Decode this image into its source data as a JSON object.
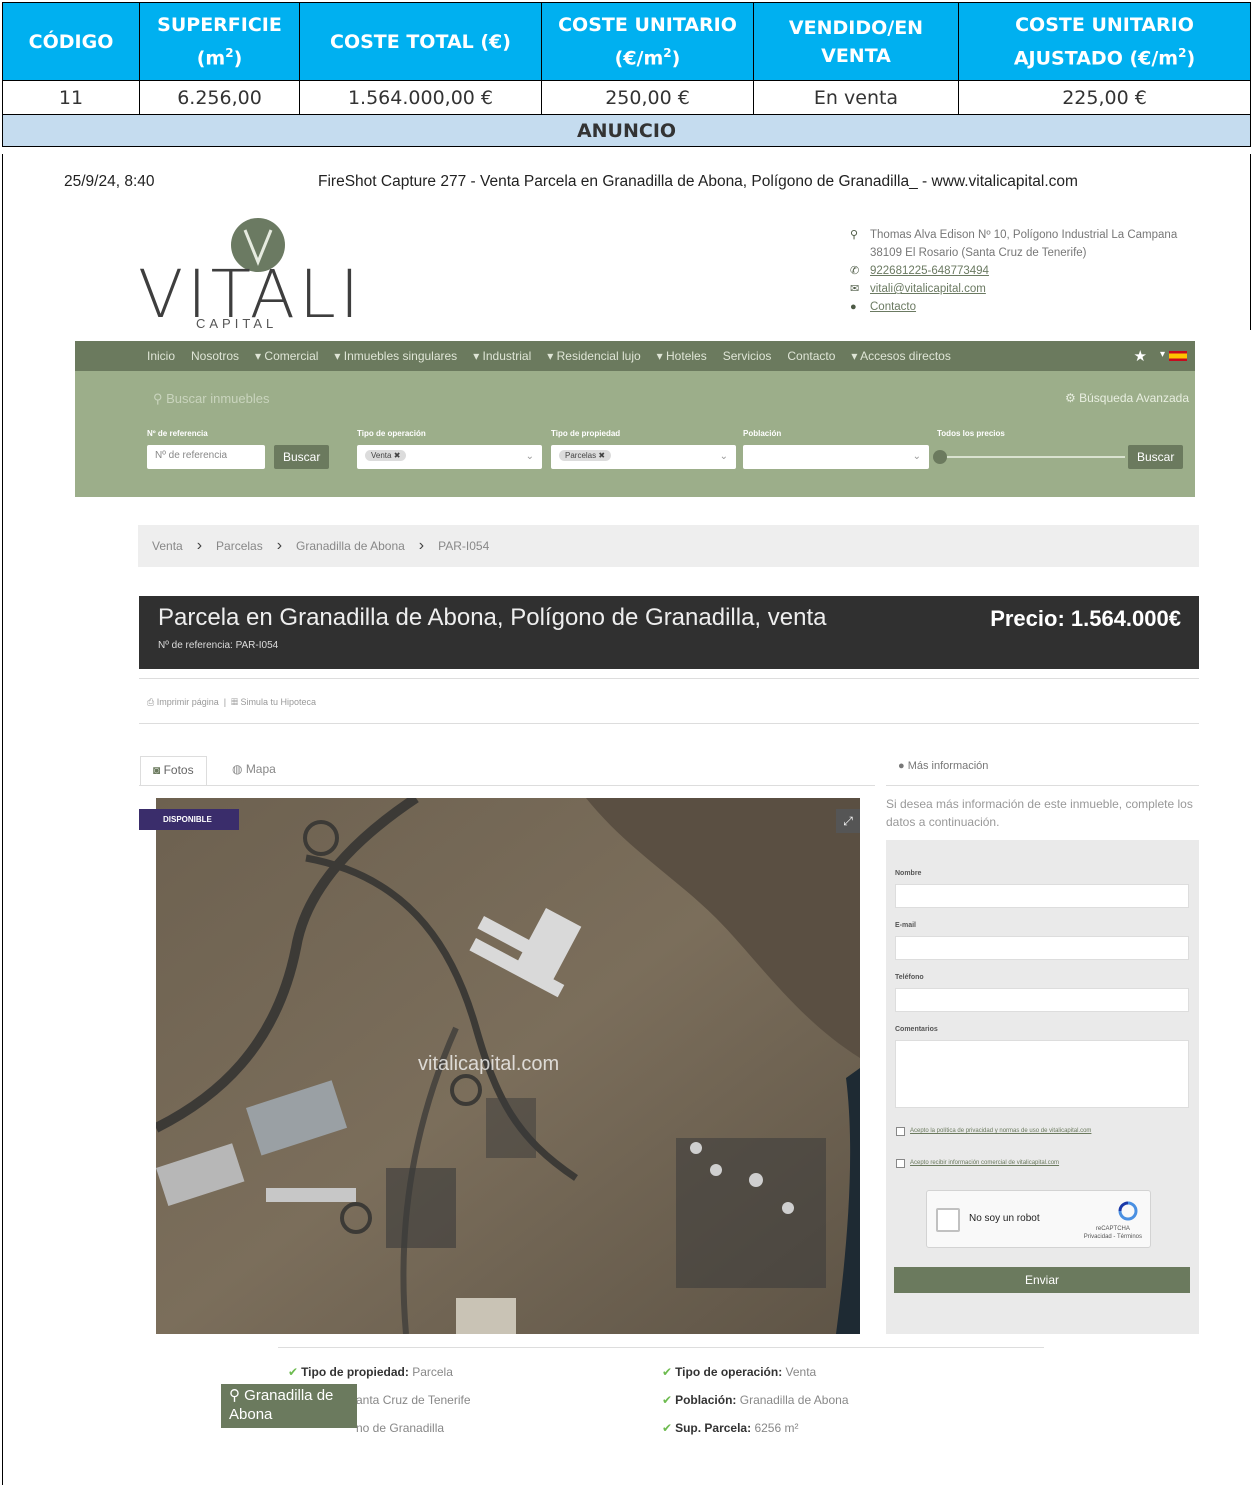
{
  "table": {
    "headers": [
      "CÓDIGO",
      "SUPERFICIE (m²)",
      "COSTE TOTAL (€)",
      "COSTE UNITARIO (€/m²)",
      "VENDIDO/EN VENTA",
      "COSTE UNITARIO AJUSTADO (€/m²)"
    ],
    "header_parts": {
      "codigo": "CÓDIGO",
      "superficie": "SUPERFICIE",
      "superficie_unit": "(m",
      "coste_total": "COSTE TOTAL (€)",
      "coste_unitario": "COSTE UNITARIO",
      "coste_unitario_unit": "(€/m",
      "vendido": "VENDIDO/EN VENTA",
      "ajustado": "COSTE UNITARIO AJUSTADO (€/m"
    },
    "row": [
      "11",
      "6.256,00",
      "1.564.000,00 €",
      "250,00 €",
      "En venta",
      "225,00 €"
    ],
    "section": "ANUNCIO"
  },
  "capture": {
    "date": "25/9/24, 8:40",
    "title": "FireShot Capture 277 - Venta Parcela en Granadilla de Abona, Polígono de Granadilla_ - www.vitalicapital.com"
  },
  "logo": {
    "name": "VITALI",
    "sub": "CAPITAL"
  },
  "contact": {
    "address1": "Thomas Alva Edison Nº 10, Polígono Industrial La Campana",
    "address2": "38109 El Rosario (Santa Cruz de Tenerife)",
    "phone": "922681225-648773494",
    "email": "vitali@vitalicapital.com",
    "contact_link": "Contacto"
  },
  "nav": {
    "items": [
      "Inicio",
      "Nosotros",
      "▾ Comercial",
      "▾ Inmuebles singulares",
      "▾ Industrial",
      "▾ Residencial lujo",
      "▾ Hoteles",
      "Servicios",
      "Contacto",
      "▾ Accesos directos"
    ]
  },
  "search": {
    "query_placeholder": "Buscar inmuebles",
    "advanced": "Búsqueda Avanzada",
    "label_ref": "Nº de referencia",
    "label_operation": "Tipo de operación",
    "label_property": "Tipo de propiedad",
    "label_population": "Población",
    "label_price": "Todos los precios",
    "ref_placeholder": "Nº de referencia",
    "btn1": "Buscar",
    "op_chip": "Venta ✖",
    "prop_chip": "Parcelas ✖",
    "btn2": "Buscar"
  },
  "breadcrumb": [
    "Venta",
    "Parcelas",
    "Granadilla de Abona",
    "PAR-I054"
  ],
  "listing": {
    "title": "Parcela en Granadilla de Abona, Polígono de Granadilla, venta",
    "ref": "Nº de referencia: PAR-I054",
    "price": "Precio: 1.564.000€",
    "print": "Imprimir página",
    "simulate": "Simula tu Hipoteca",
    "tab_photos": "Fotos",
    "tab_map": "Mapa",
    "badge": "DISPONIBLE",
    "watermark": "vitalicapital.com"
  },
  "form": {
    "more_info": "Más información",
    "intro": "Si desea más información de este inmueble, complete los datos a continuación.",
    "name": "Nombre",
    "email": "E-mail",
    "phone": "Teléfono",
    "comments": "Comentarios",
    "accept1": "Acepto la política de privacidad y normas de uso de vitalicapital.com",
    "accept2": "Acepto recibir información comercial de vitalicapital.com",
    "captcha": "No soy un robot",
    "captcha_brand": "reCAPTCHA",
    "captcha_links": "Privacidad - Términos",
    "send": "Enviar"
  },
  "features": {
    "k1": "Tipo de propiedad:",
    "v1": "Parcela",
    "k2": "Tipo de operación:",
    "v2": "Venta",
    "v3": "anta Cruz de Tenerife",
    "k4": "Población:",
    "v4": "Granadilla de Abona",
    "v5": "no de Granadilla",
    "k6": "Sup. Parcela:",
    "v6": "6256 m²",
    "location_tag": "Granadilla de Abona"
  },
  "colors": {
    "header_blue": "#00b0f0",
    "section_blue": "#c5dcef",
    "brand_green": "#6b7a5e",
    "search_green": "#9cae8a"
  }
}
